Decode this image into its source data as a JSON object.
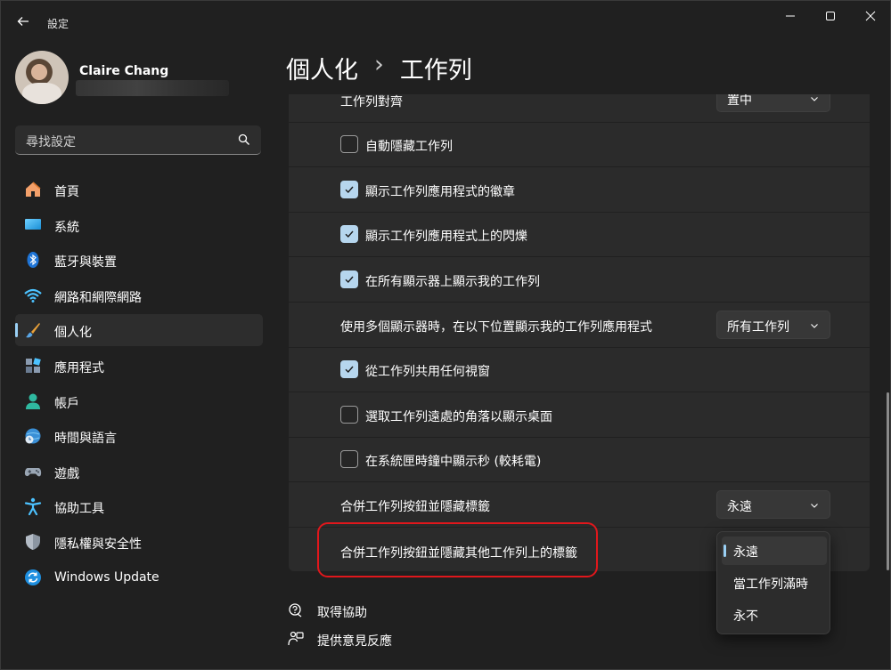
{
  "app": {
    "title": "設定"
  },
  "profile": {
    "name": "Claire Chang"
  },
  "search": {
    "placeholder": "尋找設定"
  },
  "nav": {
    "items": [
      {
        "label": "首頁",
        "icon": "home-icon"
      },
      {
        "label": "系統",
        "icon": "monitor-icon"
      },
      {
        "label": "藍牙與裝置",
        "icon": "bluetooth-icon"
      },
      {
        "label": "網路和網際網路",
        "icon": "wifi-icon"
      },
      {
        "label": "個人化",
        "icon": "brush-icon",
        "active": true
      },
      {
        "label": "應用程式",
        "icon": "apps-icon"
      },
      {
        "label": "帳戶",
        "icon": "account-icon"
      },
      {
        "label": "時間與語言",
        "icon": "globe-clock-icon"
      },
      {
        "label": "遊戲",
        "icon": "gamepad-icon"
      },
      {
        "label": "協助工具",
        "icon": "accessibility-icon"
      },
      {
        "label": "隱私權與安全性",
        "icon": "shield-icon"
      },
      {
        "label": "Windows Update",
        "icon": "update-icon"
      }
    ]
  },
  "header": {
    "breadcrumb_parent": "個人化",
    "separator": "›",
    "title": "工作列"
  },
  "settings": {
    "alignment": {
      "label": "工作列對齊",
      "value": "置中"
    },
    "auto_hide": {
      "label": "自動隱藏工作列",
      "checked": false
    },
    "show_badges": {
      "label": "顯示工作列應用程式的徽章",
      "checked": true
    },
    "show_flashing": {
      "label": "顯示工作列應用程式上的閃爍",
      "checked": true
    },
    "all_displays": {
      "label": "在所有顯示器上顯示我的工作列",
      "checked": true
    },
    "multi_display": {
      "label": "使用多個顯示器時，在以下位置顯示我的工作列應用程式",
      "value": "所有工作列"
    },
    "share_window": {
      "label": "從工作列共用任何視窗",
      "checked": true
    },
    "far_corner": {
      "label": "選取工作列遠處的角落以顯示桌面",
      "checked": false
    },
    "show_seconds": {
      "label": "在系統匣時鐘中顯示秒 (較耗電)",
      "checked": false
    },
    "combine": {
      "label": "合併工作列按鈕並隱藏標籤",
      "value": "永遠"
    },
    "combine_other": {
      "label": "合併工作列按鈕並隱藏其他工作列上的標籤"
    }
  },
  "popup": {
    "options": [
      "永遠",
      "當工作列滿時",
      "永不"
    ],
    "selected_index": 0
  },
  "footer": {
    "help": "取得協助",
    "feedback": "提供意見反應"
  },
  "colors": {
    "accent": "#9ad0f5",
    "checkbox_on": "#b6d6ee",
    "highlight": "#e0171c"
  }
}
